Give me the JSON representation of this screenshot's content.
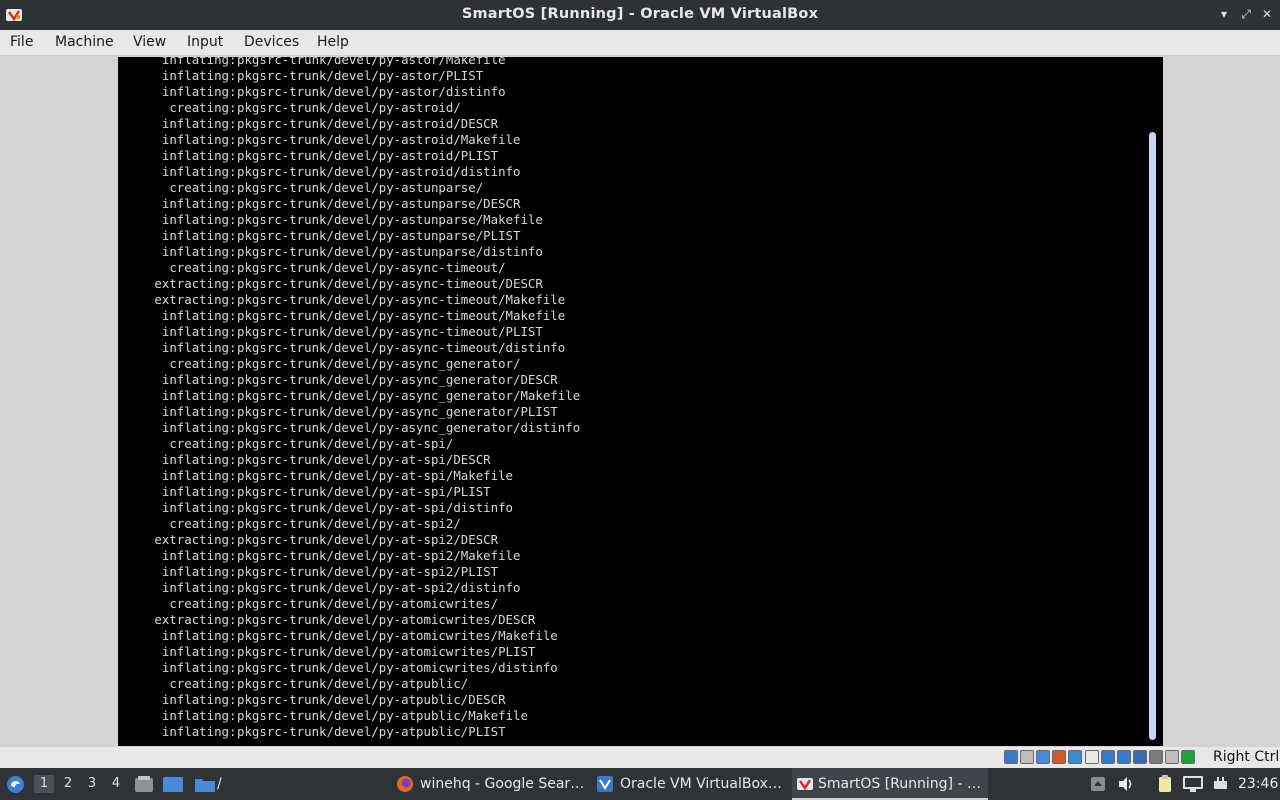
{
  "window": {
    "title": "SmartOS [Running] - Oracle VM VirtualBox",
    "minimize_glyph": "▾",
    "maximize_glyph": "⤢",
    "close_glyph": "✕"
  },
  "menu": [
    "File",
    "Machine",
    "View",
    "Input",
    "Devices",
    "Help"
  ],
  "console_lines": [
    {
      "action": "inflating",
      "path": "pkgsrc-trunk/devel/py-astor/Makefile"
    },
    {
      "action": "inflating",
      "path": "pkgsrc-trunk/devel/py-astor/PLIST"
    },
    {
      "action": "inflating",
      "path": "pkgsrc-trunk/devel/py-astor/distinfo"
    },
    {
      "action": "creating",
      "path": "pkgsrc-trunk/devel/py-astroid/"
    },
    {
      "action": "inflating",
      "path": "pkgsrc-trunk/devel/py-astroid/DESCR"
    },
    {
      "action": "inflating",
      "path": "pkgsrc-trunk/devel/py-astroid/Makefile"
    },
    {
      "action": "inflating",
      "path": "pkgsrc-trunk/devel/py-astroid/PLIST"
    },
    {
      "action": "inflating",
      "path": "pkgsrc-trunk/devel/py-astroid/distinfo"
    },
    {
      "action": "creating",
      "path": "pkgsrc-trunk/devel/py-astunparse/"
    },
    {
      "action": "inflating",
      "path": "pkgsrc-trunk/devel/py-astunparse/DESCR"
    },
    {
      "action": "inflating",
      "path": "pkgsrc-trunk/devel/py-astunparse/Makefile"
    },
    {
      "action": "inflating",
      "path": "pkgsrc-trunk/devel/py-astunparse/PLIST"
    },
    {
      "action": "inflating",
      "path": "pkgsrc-trunk/devel/py-astunparse/distinfo"
    },
    {
      "action": "creating",
      "path": "pkgsrc-trunk/devel/py-async-timeout/"
    },
    {
      "action": "extracting",
      "path": "pkgsrc-trunk/devel/py-async-timeout/DESCR"
    },
    {
      "action": "extracting",
      "path": "pkgsrc-trunk/devel/py-async-timeout/Makefile"
    },
    {
      "action": "inflating",
      "path": "pkgsrc-trunk/devel/py-async-timeout/Makefile"
    },
    {
      "action": "inflating",
      "path": "pkgsrc-trunk/devel/py-async-timeout/PLIST"
    },
    {
      "action": "inflating",
      "path": "pkgsrc-trunk/devel/py-async-timeout/distinfo"
    },
    {
      "action": "creating",
      "path": "pkgsrc-trunk/devel/py-async_generator/"
    },
    {
      "action": "inflating",
      "path": "pkgsrc-trunk/devel/py-async_generator/DESCR"
    },
    {
      "action": "inflating",
      "path": "pkgsrc-trunk/devel/py-async_generator/Makefile"
    },
    {
      "action": "inflating",
      "path": "pkgsrc-trunk/devel/py-async_generator/PLIST"
    },
    {
      "action": "inflating",
      "path": "pkgsrc-trunk/devel/py-async_generator/distinfo"
    },
    {
      "action": "creating",
      "path": "pkgsrc-trunk/devel/py-at-spi/"
    },
    {
      "action": "inflating",
      "path": "pkgsrc-trunk/devel/py-at-spi/DESCR"
    },
    {
      "action": "inflating",
      "path": "pkgsrc-trunk/devel/py-at-spi/Makefile"
    },
    {
      "action": "inflating",
      "path": "pkgsrc-trunk/devel/py-at-spi/PLIST"
    },
    {
      "action": "inflating",
      "path": "pkgsrc-trunk/devel/py-at-spi/distinfo"
    },
    {
      "action": "creating",
      "path": "pkgsrc-trunk/devel/py-at-spi2/"
    },
    {
      "action": "extracting",
      "path": "pkgsrc-trunk/devel/py-at-spi2/DESCR"
    },
    {
      "action": "inflating",
      "path": "pkgsrc-trunk/devel/py-at-spi2/Makefile"
    },
    {
      "action": "inflating",
      "path": "pkgsrc-trunk/devel/py-at-spi2/PLIST"
    },
    {
      "action": "inflating",
      "path": "pkgsrc-trunk/devel/py-at-spi2/distinfo"
    },
    {
      "action": "creating",
      "path": "pkgsrc-trunk/devel/py-atomicwrites/"
    },
    {
      "action": "extracting",
      "path": "pkgsrc-trunk/devel/py-atomicwrites/DESCR"
    },
    {
      "action": "inflating",
      "path": "pkgsrc-trunk/devel/py-atomicwrites/Makefile"
    },
    {
      "action": "inflating",
      "path": "pkgsrc-trunk/devel/py-atomicwrites/PLIST"
    },
    {
      "action": "inflating",
      "path": "pkgsrc-trunk/devel/py-atomicwrites/distinfo"
    },
    {
      "action": "creating",
      "path": "pkgsrc-trunk/devel/py-atpublic/"
    },
    {
      "action": "inflating",
      "path": "pkgsrc-trunk/devel/py-atpublic/DESCR"
    },
    {
      "action": "inflating",
      "path": "pkgsrc-trunk/devel/py-atpublic/Makefile"
    },
    {
      "action": "inflating",
      "path": "pkgsrc-trunk/devel/py-atpublic/PLIST"
    }
  ],
  "statusbar": {
    "host_key": "Right Ctrl",
    "icons": [
      {
        "name": "hard-disk-icon",
        "color": "#3a78c8"
      },
      {
        "name": "optical-drive-icon",
        "color": "#bdbdbd"
      },
      {
        "name": "audio-icon",
        "color": "#4a8ad8"
      },
      {
        "name": "network-icon",
        "color": "#d05a30"
      },
      {
        "name": "usb-icon",
        "color": "#3a8ad0"
      },
      {
        "name": "shared-folders-icon",
        "color": "#e8e8e8"
      },
      {
        "name": "display-icon",
        "color": "#3a78c8"
      },
      {
        "name": "video-capture-icon",
        "color": "#3a78c8"
      },
      {
        "name": "recording-icon",
        "color": "#3a6ab0"
      },
      {
        "name": "cpu-icon",
        "color": "#7a7a7a"
      },
      {
        "name": "mouse-integration-icon",
        "color": "#bdbdbd"
      },
      {
        "name": "keyboard-capture-icon",
        "color": "#20a040"
      }
    ]
  },
  "taskbar": {
    "workspaces": [
      "1",
      "2",
      "3",
      "4"
    ],
    "path_label": "/",
    "tasks": [
      {
        "label": "winehq - Google Sear…",
        "icon": "firefox-icon",
        "active": false
      },
      {
        "label": "Oracle VM VirtualBox…",
        "icon": "virtualbox-icon",
        "active": false
      },
      {
        "label": "SmartOS [Running] - …",
        "icon": "virtualbox-vm-icon",
        "active": true
      }
    ],
    "clock": "23:46"
  }
}
